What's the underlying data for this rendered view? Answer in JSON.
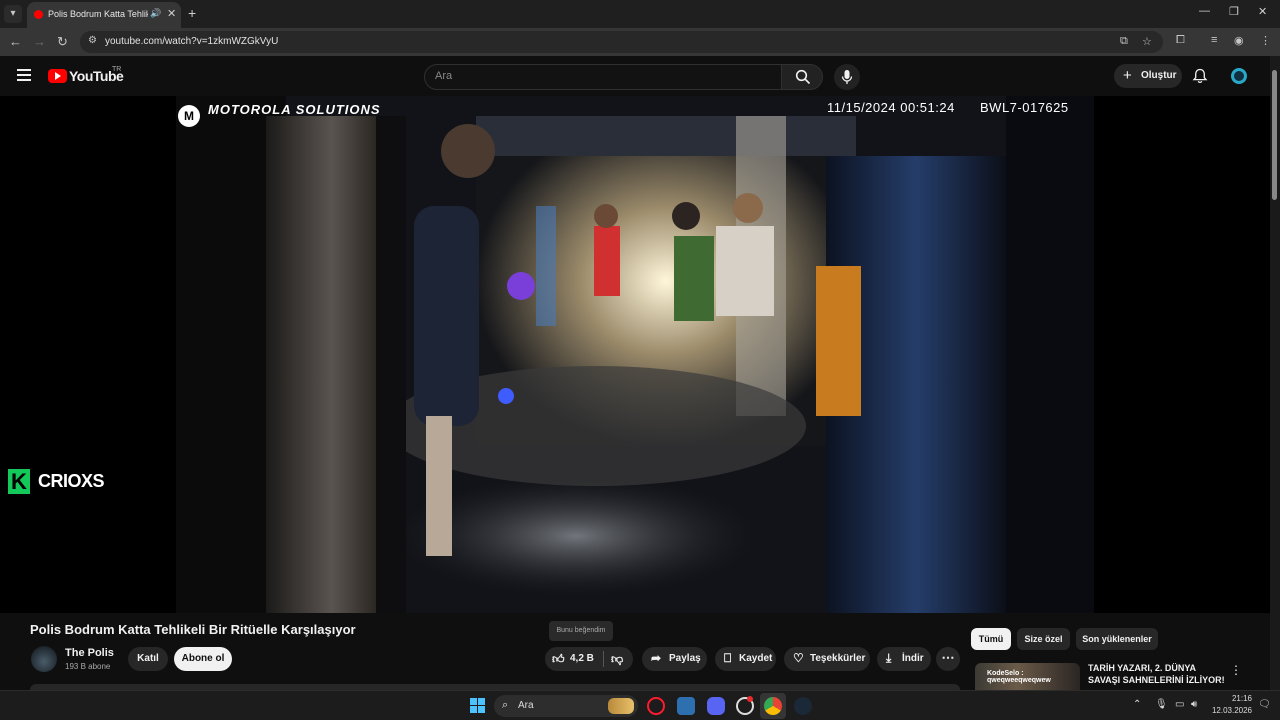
{
  "browser": {
    "tab_title": "Polis Bodrum Katta Tehlikeli Bir Ritüelle Karşılaşıyor - YouTube",
    "url": "youtube.com/watch?v=1zkmWZGkVyU",
    "new_tab": "+",
    "tab_close": "✕",
    "tab_audio": "🔊",
    "minimize": "—",
    "restore": "❐",
    "close": "✕"
  },
  "youtube": {
    "logo_text": "YouTube",
    "country": "TR",
    "search_placeholder": "Ara",
    "create_label": "Oluştur"
  },
  "video": {
    "brand": "MOTOROLA SOLUTIONS",
    "timestamp": "11/15/2024 00:51:24",
    "camera_id": "BWL7-017625",
    "watermark": "CRIOXS",
    "watermark_letter": "K"
  },
  "details": {
    "title": "Polis Bodrum Katta Tehlikeli Bir Ritüelle Karşılaşıyor",
    "channel_name": "The Polis",
    "subscribers": "193 B abone",
    "join_label": "Katıl",
    "subscribe_label": "Abone ol",
    "like_tooltip": "Bunu beğendim",
    "like_count": "4,2 B",
    "share_label": "Paylaş",
    "save_label": "Kaydet",
    "thanks_label": "Teşekkürler",
    "download_label": "İndir"
  },
  "sidebar": {
    "chips": [
      "Tümü",
      "Size özel",
      "Son yüklenenler"
    ],
    "rec_title": "TARİH YAZARI, 2. DÜNYA SAVAŞI SAHNELERİNİ İZLİYOR!",
    "rec_overlay": "KodeSelo : qweqweeqweqwew"
  },
  "taskbar": {
    "search_label": "Ara",
    "time": "21:16",
    "date": "12.03.2026"
  },
  "colors": {
    "youtube_red": "#ff0000",
    "background": "#0f0f0f",
    "watermark_green": "#12c95a"
  }
}
